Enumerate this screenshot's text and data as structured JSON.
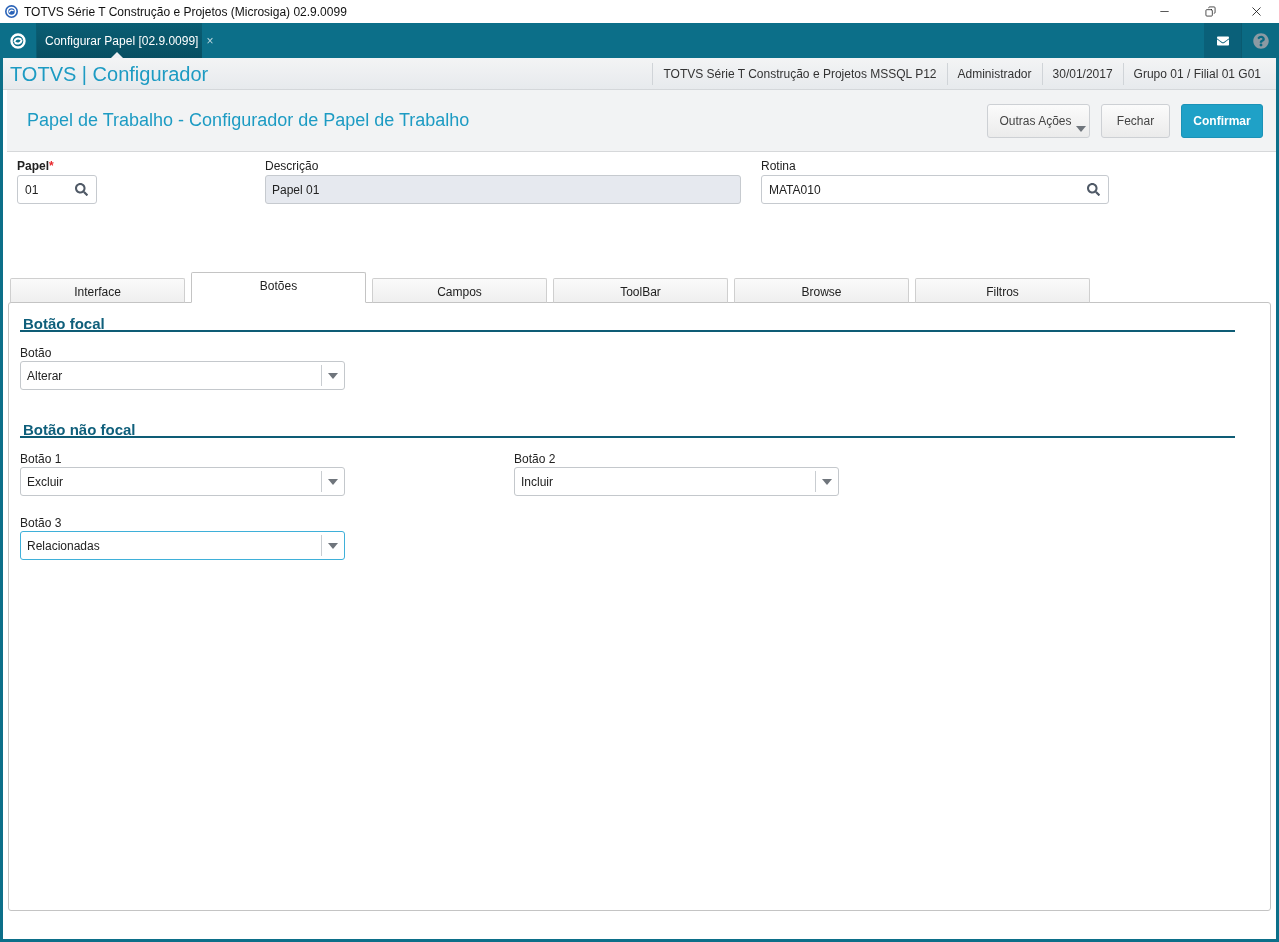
{
  "window": {
    "title": "TOTVS Série T Construção e Projetos (Microsiga) 02.9.0099"
  },
  "nav": {
    "tabs": [
      {
        "label": "Configurar Papel [02.9.0099]",
        "close": "×",
        "selected": true
      }
    ]
  },
  "header": {
    "title": "TOTVS | Configurador",
    "info": [
      "TOTVS Série T Construção e Projetos MSSQL P12",
      "Administrador",
      "30/01/2017",
      "Grupo 01 / Filial 01 G01"
    ]
  },
  "page": {
    "title": "Papel de Trabalho - Configurador de Papel de Trabalho",
    "actions": [
      {
        "label": "Outras Ações",
        "kind": "menu"
      },
      {
        "label": "Fechar",
        "kind": "secondary"
      },
      {
        "label": "Confirmar",
        "kind": "primary"
      }
    ]
  },
  "fields": [
    {
      "label": "Papel",
      "required_mark": "*",
      "value": "01",
      "kind": "lookup"
    },
    {
      "label": "Descrição",
      "value": "Papel 01",
      "kind": "readonly"
    },
    {
      "label": "Rotina",
      "value": "MATA010",
      "kind": "lookup"
    }
  ],
  "tabs": [
    {
      "label": "Interface",
      "selected": false
    },
    {
      "label": "Botões",
      "selected": true
    },
    {
      "label": "Campos",
      "selected": false
    },
    {
      "label": "ToolBar",
      "selected": false
    },
    {
      "label": "Browse",
      "selected": false
    },
    {
      "label": "Filtros",
      "selected": false
    }
  ],
  "sections": [
    {
      "title": "Botão focal",
      "fields": [
        {
          "label": "Botão",
          "value": "Alterar",
          "focused": false
        }
      ]
    },
    {
      "title": "Botão não focal",
      "fields": [
        {
          "label": "Botão 1",
          "value": "Excluir",
          "focused": false
        },
        {
          "label": "Botão 2",
          "value": "Incluir",
          "focused": false
        },
        {
          "label": "Botão 3",
          "value": "Relacionadas",
          "focused": true
        }
      ]
    }
  ]
}
